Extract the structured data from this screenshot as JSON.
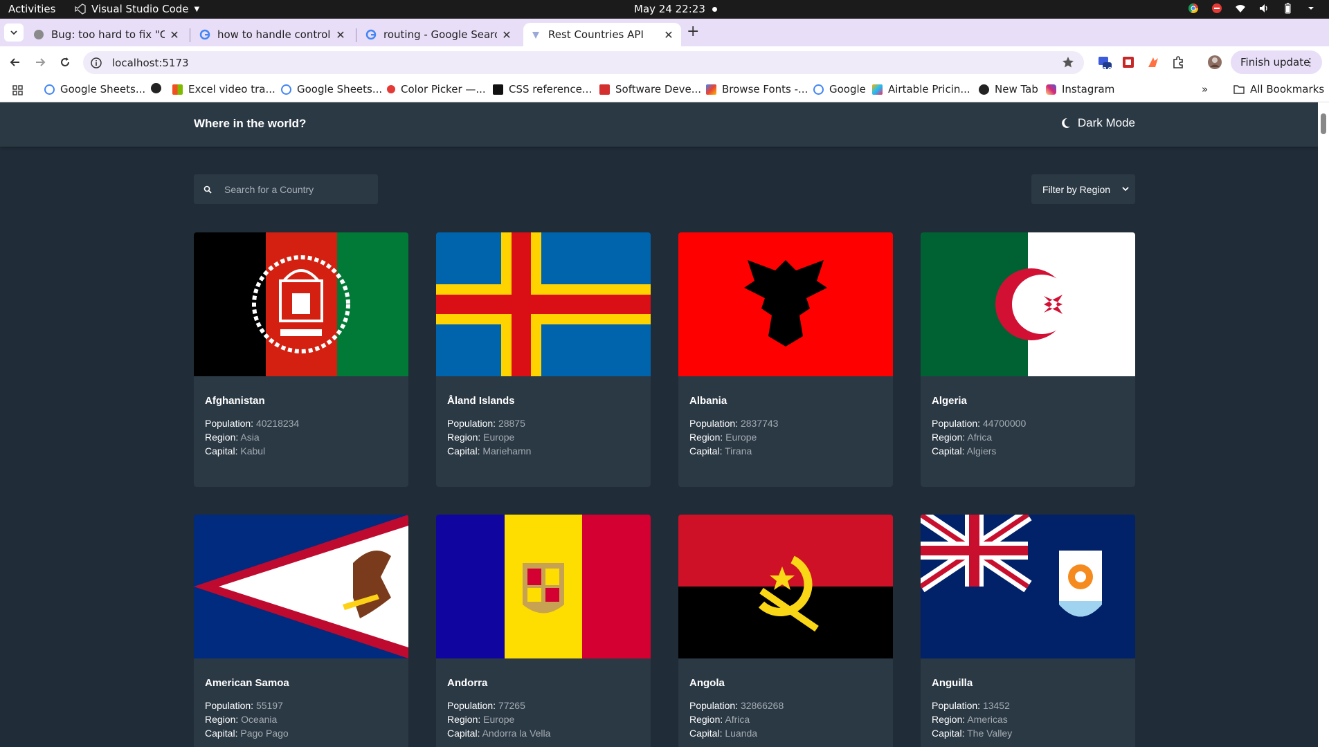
{
  "os_bar": {
    "activities": "Activities",
    "app_name": "Visual Studio Code",
    "clock": "May 24  22:23"
  },
  "browser": {
    "tabs": [
      {
        "title": "Bug: too hard to fix \"Can"
      },
      {
        "title": "how to handle controlle"
      },
      {
        "title": "routing - Google Search"
      },
      {
        "title": "Rest Countries API"
      }
    ],
    "url": "localhost:5173",
    "ext_badge": "10",
    "finish_update": "Finish update",
    "bookmarks": [
      "Google Sheets...",
      "Excel video tra...",
      "Google Sheets...",
      "Color Picker —...",
      "CSS reference...",
      "Software Deve...",
      "Browse Fonts -...",
      "Google",
      "Airtable Pricin...",
      "New Tab",
      "Instagram"
    ],
    "all_bookmarks": "All Bookmarks"
  },
  "app": {
    "title": "Where in the world?",
    "dark_mode_label": "Dark Mode",
    "search_placeholder": "Search for a Country",
    "filter_label": "Filter by Region",
    "labels": {
      "population": "Population:",
      "region": "Region:",
      "capital": "Capital:"
    },
    "countries": [
      {
        "name": "Afghanistan",
        "population": "40218234",
        "region": "Asia",
        "capital": "Kabul",
        "flag": "afghanistan-flag"
      },
      {
        "name": "Åland Islands",
        "population": "28875",
        "region": "Europe",
        "capital": "Mariehamn",
        "flag": "aland-flag"
      },
      {
        "name": "Albania",
        "population": "2837743",
        "region": "Europe",
        "capital": "Tirana",
        "flag": "albania-flag"
      },
      {
        "name": "Algeria",
        "population": "44700000",
        "region": "Africa",
        "capital": "Algiers",
        "flag": "algeria-flag"
      },
      {
        "name": "American Samoa",
        "population": "55197",
        "region": "Oceania",
        "capital": "Pago Pago",
        "flag": "american-samoa-flag"
      },
      {
        "name": "Andorra",
        "population": "77265",
        "region": "Europe",
        "capital": "Andorra la Vella",
        "flag": "andorra-flag"
      },
      {
        "name": "Angola",
        "population": "32866268",
        "region": "Africa",
        "capital": "Luanda",
        "flag": "angola-flag"
      },
      {
        "name": "Anguilla",
        "population": "13452",
        "region": "Americas",
        "capital": "The Valley",
        "flag": "anguilla-flag"
      }
    ]
  },
  "colors": {
    "page_bg": "#202c37",
    "element_bg": "#2b3945",
    "tabstrip_bg": "#e8def8"
  }
}
